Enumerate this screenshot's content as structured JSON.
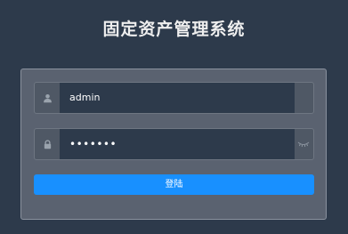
{
  "page": {
    "title": "固定资产管理系统"
  },
  "login_form": {
    "username": {
      "value": "admin",
      "icon": "user-icon"
    },
    "password": {
      "value": "•••••••",
      "icon": "lock-icon",
      "toggle_icon": "eye-closed-icon"
    },
    "submit_label": "登陆"
  },
  "colors": {
    "background": "#2d3a4b",
    "panel": "#5a6270",
    "accent": "#1890ff"
  }
}
